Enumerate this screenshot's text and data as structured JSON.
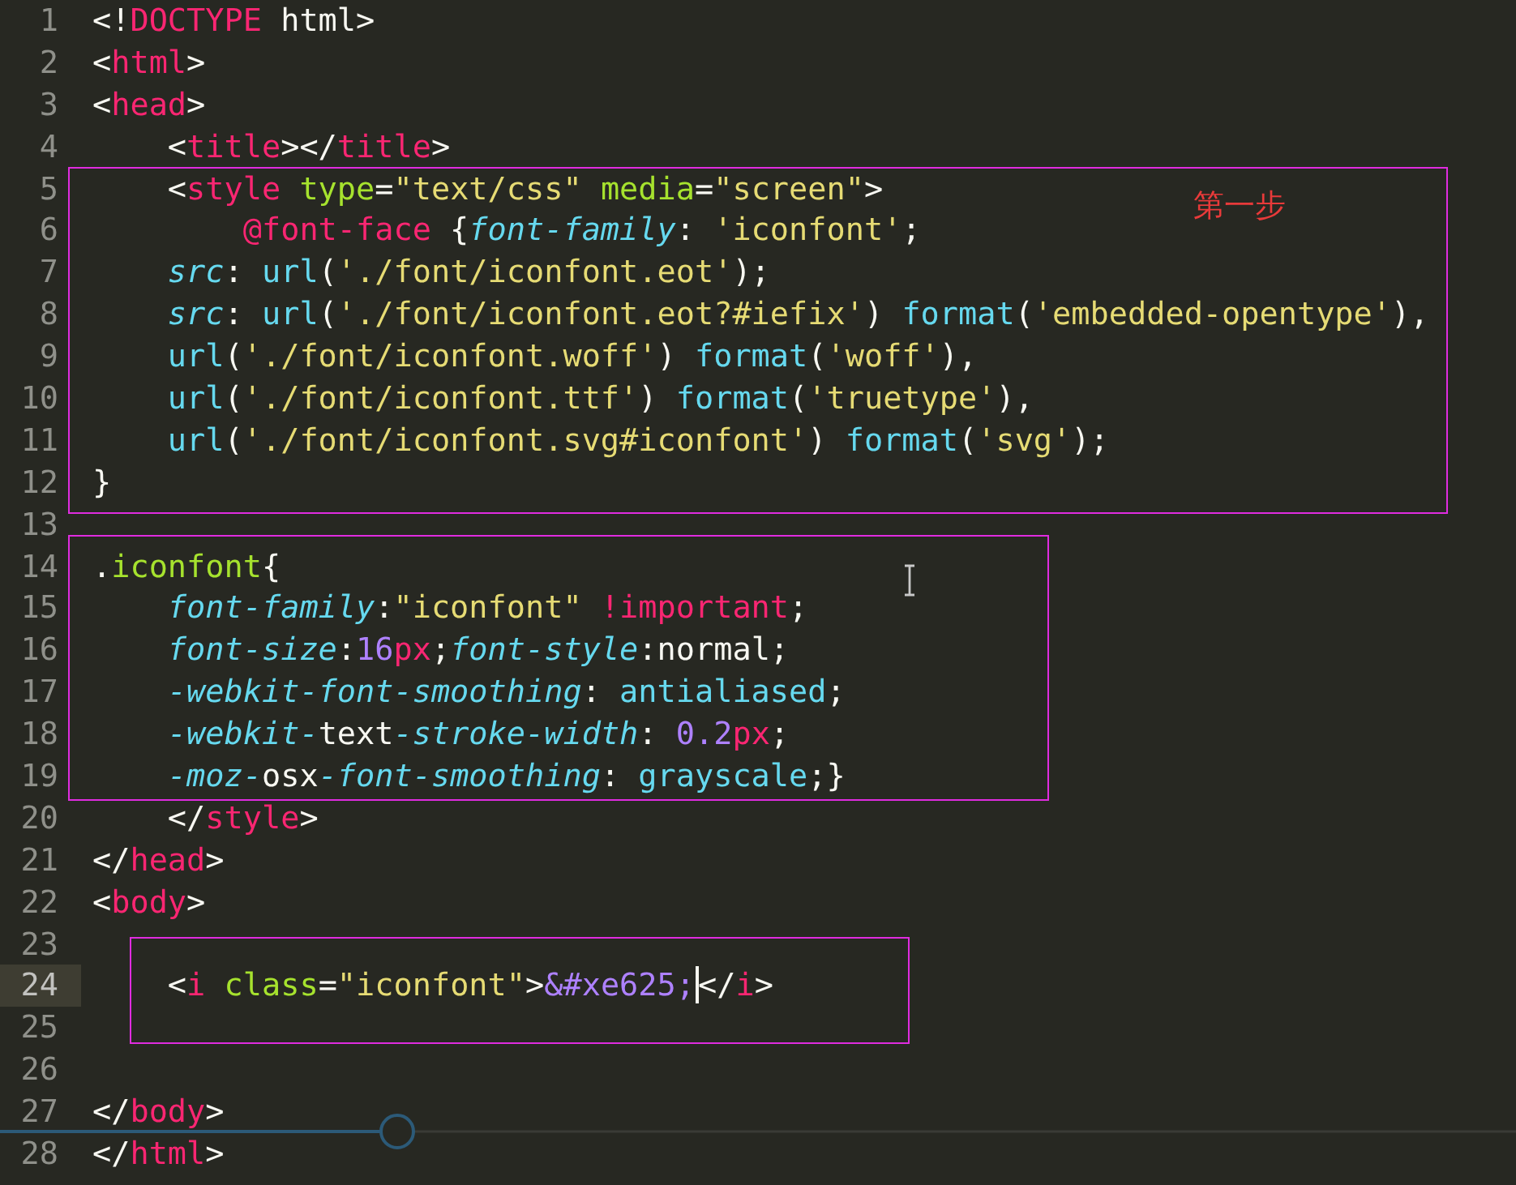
{
  "lines": [
    {
      "number": "1",
      "selected": false,
      "tokens": [
        {
          "text": "<!",
          "kind": "punct"
        },
        {
          "text": "DOCTYPE",
          "kind": "tag"
        },
        {
          "text": " html>",
          "kind": "punct"
        }
      ]
    },
    {
      "number": "2",
      "selected": false,
      "tokens": [
        {
          "text": "<",
          "kind": "punct"
        },
        {
          "text": "html",
          "kind": "tag"
        },
        {
          "text": ">",
          "kind": "punct"
        }
      ]
    },
    {
      "number": "3",
      "selected": false,
      "tokens": [
        {
          "text": "<",
          "kind": "punct"
        },
        {
          "text": "head",
          "kind": "tag"
        },
        {
          "text": ">",
          "kind": "punct"
        }
      ]
    },
    {
      "number": "4",
      "selected": false,
      "tokens": [
        {
          "text": "    <",
          "kind": "punct"
        },
        {
          "text": "title",
          "kind": "tag"
        },
        {
          "text": "></",
          "kind": "punct"
        },
        {
          "text": "title",
          "kind": "tag"
        },
        {
          "text": ">",
          "kind": "punct"
        }
      ]
    },
    {
      "number": "5",
      "selected": false,
      "tokens": [
        {
          "text": "    <",
          "kind": "punct"
        },
        {
          "text": "style",
          "kind": "tag"
        },
        {
          "text": " type",
          "kind": "attr"
        },
        {
          "text": "=",
          "kind": "punct"
        },
        {
          "text": "\"text/css\"",
          "kind": "string"
        },
        {
          "text": " media",
          "kind": "attr"
        },
        {
          "text": "=",
          "kind": "punct"
        },
        {
          "text": "\"screen\"",
          "kind": "string"
        },
        {
          "text": ">",
          "kind": "punct"
        }
      ]
    },
    {
      "number": "6",
      "selected": false,
      "tokens": [
        {
          "text": "        @font-face",
          "kind": "tag"
        },
        {
          "text": " {",
          "kind": "punct"
        },
        {
          "text": "font-family",
          "kind": "prop"
        },
        {
          "text": ": ",
          "kind": "punct"
        },
        {
          "text": "'iconfont'",
          "kind": "string"
        },
        {
          "text": ";",
          "kind": "punct"
        }
      ]
    },
    {
      "number": "7",
      "selected": false,
      "tokens": [
        {
          "text": "    src",
          "kind": "prop"
        },
        {
          "text": ": ",
          "kind": "punct"
        },
        {
          "text": "url",
          "kind": "func"
        },
        {
          "text": "(",
          "kind": "punct"
        },
        {
          "text": "'./font/iconfont.eot'",
          "kind": "string"
        },
        {
          "text": ");",
          "kind": "punct"
        }
      ]
    },
    {
      "number": "8",
      "selected": false,
      "tokens": [
        {
          "text": "    src",
          "kind": "prop"
        },
        {
          "text": ": ",
          "kind": "punct"
        },
        {
          "text": "url",
          "kind": "func"
        },
        {
          "text": "(",
          "kind": "punct"
        },
        {
          "text": "'./font/iconfont.eot?#iefix'",
          "kind": "string"
        },
        {
          "text": ") ",
          "kind": "punct"
        },
        {
          "text": "format",
          "kind": "func"
        },
        {
          "text": "(",
          "kind": "punct"
        },
        {
          "text": "'embedded-opentype'",
          "kind": "string"
        },
        {
          "text": "),",
          "kind": "punct"
        }
      ]
    },
    {
      "number": "9",
      "selected": false,
      "tokens": [
        {
          "text": "    url",
          "kind": "func"
        },
        {
          "text": "(",
          "kind": "punct"
        },
        {
          "text": "'./font/iconfont.woff'",
          "kind": "string"
        },
        {
          "text": ") ",
          "kind": "punct"
        },
        {
          "text": "format",
          "kind": "func"
        },
        {
          "text": "(",
          "kind": "punct"
        },
        {
          "text": "'woff'",
          "kind": "string"
        },
        {
          "text": "),",
          "kind": "punct"
        }
      ]
    },
    {
      "number": "10",
      "selected": false,
      "tokens": [
        {
          "text": "    url",
          "kind": "func"
        },
        {
          "text": "(",
          "kind": "punct"
        },
        {
          "text": "'./font/iconfont.ttf'",
          "kind": "string"
        },
        {
          "text": ") ",
          "kind": "punct"
        },
        {
          "text": "format",
          "kind": "func"
        },
        {
          "text": "(",
          "kind": "punct"
        },
        {
          "text": "'truetype'",
          "kind": "string"
        },
        {
          "text": "),",
          "kind": "punct"
        }
      ]
    },
    {
      "number": "11",
      "selected": false,
      "tokens": [
        {
          "text": "    url",
          "kind": "func"
        },
        {
          "text": "(",
          "kind": "punct"
        },
        {
          "text": "'./font/iconfont.svg#iconfont'",
          "kind": "string"
        },
        {
          "text": ") ",
          "kind": "punct"
        },
        {
          "text": "format",
          "kind": "func"
        },
        {
          "text": "(",
          "kind": "punct"
        },
        {
          "text": "'svg'",
          "kind": "string"
        },
        {
          "text": ");",
          "kind": "punct"
        }
      ]
    },
    {
      "number": "12",
      "selected": false,
      "tokens": [
        {
          "text": "}",
          "kind": "punct"
        }
      ]
    },
    {
      "number": "13",
      "selected": false
    },
    {
      "number": "14",
      "selected": false,
      "tokens": [
        {
          "text": ".",
          "kind": "punct"
        },
        {
          "text": "iconfont",
          "kind": "attr"
        },
        {
          "text": "{",
          "kind": "punct"
        }
      ]
    },
    {
      "number": "15",
      "selected": false,
      "tokens": [
        {
          "text": "    font-family",
          "kind": "prop"
        },
        {
          "text": ":",
          "kind": "punct"
        },
        {
          "text": "\"iconfont\"",
          "kind": "string"
        },
        {
          "text": " !important",
          "kind": "tag"
        },
        {
          "text": ";",
          "kind": "punct"
        }
      ]
    },
    {
      "number": "16",
      "selected": false,
      "tokens": [
        {
          "text": "    font-size",
          "kind": "prop"
        },
        {
          "text": ":",
          "kind": "punct"
        },
        {
          "text": "16",
          "kind": "number"
        },
        {
          "text": "px",
          "kind": "tag"
        },
        {
          "text": ";",
          "kind": "punct"
        },
        {
          "text": "font-style",
          "kind": "prop"
        },
        {
          "text": ":normal;",
          "kind": "punct"
        }
      ]
    },
    {
      "number": "17",
      "selected": false,
      "tokens": [
        {
          "text": "    -webkit-font-smoothing",
          "kind": "prop"
        },
        {
          "text": ": ",
          "kind": "punct"
        },
        {
          "text": "antialiased",
          "kind": "func"
        },
        {
          "text": ";",
          "kind": "punct"
        }
      ]
    },
    {
      "number": "18",
      "selected": false,
      "tokens": [
        {
          "text": "    -webkit-",
          "kind": "prop"
        },
        {
          "text": "text",
          "kind": "punct"
        },
        {
          "text": "-stroke-width",
          "kind": "prop"
        },
        {
          "text": ": ",
          "kind": "punct"
        },
        {
          "text": "0.2",
          "kind": "number"
        },
        {
          "text": "px",
          "kind": "tag"
        },
        {
          "text": ";",
          "kind": "punct"
        }
      ]
    },
    {
      "number": "19",
      "selected": false,
      "tokens": [
        {
          "text": "    -moz-",
          "kind": "prop"
        },
        {
          "text": "osx",
          "kind": "punct"
        },
        {
          "text": "-font-smoothing",
          "kind": "prop"
        },
        {
          "text": ": ",
          "kind": "punct"
        },
        {
          "text": "grayscale",
          "kind": "func"
        },
        {
          "text": ";}",
          "kind": "punct"
        }
      ]
    },
    {
      "number": "20",
      "selected": false,
      "tokens": [
        {
          "text": "    </",
          "kind": "punct"
        },
        {
          "text": "style",
          "kind": "tag"
        },
        {
          "text": ">",
          "kind": "punct"
        }
      ]
    },
    {
      "number": "21",
      "selected": false,
      "tokens": [
        {
          "text": "</",
          "kind": "punct"
        },
        {
          "text": "head",
          "kind": "tag"
        },
        {
          "text": ">",
          "kind": "punct"
        }
      ]
    },
    {
      "number": "22",
      "selected": false,
      "tokens": [
        {
          "text": "<",
          "kind": "punct"
        },
        {
          "text": "body",
          "kind": "tag"
        },
        {
          "text": ">",
          "kind": "punct"
        }
      ]
    },
    {
      "number": "23",
      "selected": false
    },
    {
      "number": "24",
      "selected": true,
      "tokens": [
        {
          "text": "    <",
          "kind": "punct"
        },
        {
          "text": "i",
          "kind": "tag"
        },
        {
          "text": " class",
          "kind": "attr"
        },
        {
          "text": "=",
          "kind": "punct"
        },
        {
          "text": "\"iconfont\"",
          "kind": "string"
        },
        {
          "text": ">",
          "kind": "punct"
        },
        {
          "text": "&#xe625;",
          "kind": "number",
          "caret_after": true
        },
        {
          "text": "</",
          "kind": "punct"
        },
        {
          "text": "i",
          "kind": "tag"
        },
        {
          "text": ">",
          "kind": "punct"
        }
      ]
    },
    {
      "number": "25",
      "selected": false
    },
    {
      "number": "26",
      "selected": false
    },
    {
      "number": "27",
      "selected": false,
      "tokens": [
        {
          "text": "</",
          "kind": "punct"
        },
        {
          "text": "body",
          "kind": "tag"
        },
        {
          "text": ">",
          "kind": "punct"
        }
      ]
    },
    {
      "number": "28",
      "selected": false,
      "tokens": [
        {
          "text": "</",
          "kind": "punct"
        },
        {
          "text": "html",
          "kind": "tag"
        },
        {
          "text": ">",
          "kind": "punct"
        }
      ]
    }
  ],
  "annotations": [
    {
      "kind": "labeled_box",
      "label": "第一步"
    },
    {
      "kind": "box"
    },
    {
      "kind": "box"
    }
  ]
}
